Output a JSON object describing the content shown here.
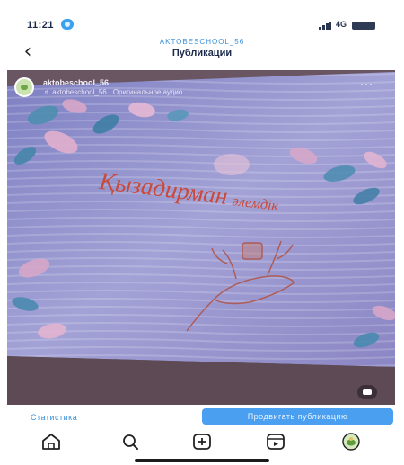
{
  "status_bar": {
    "time": "11:21",
    "network": "4G"
  },
  "header": {
    "account": "AKTOBESCHOOL_56",
    "title": "Публикации"
  },
  "post": {
    "username": "aktobeschool_56",
    "audio": "♬ aktobeschool_56 · Оригинальное аудио",
    "banner_title": "Қызадирман",
    "banner_subtitle": "әлемдік",
    "more_icon": "more-horizontal-icon",
    "mute_icon": "volume-muted-icon"
  },
  "actions": {
    "statistics": "Статистика",
    "promote": "Продвигать публикацию"
  },
  "tabbar": {
    "items": [
      "home-icon",
      "search-icon",
      "create-icon",
      "reels-icon",
      "profile-avatar"
    ]
  },
  "colors": {
    "accent": "#3a8fd8",
    "promote_button": "#4a9ff0",
    "banner_text": "#c94a3a",
    "screen_background": "#8f8fc6"
  }
}
